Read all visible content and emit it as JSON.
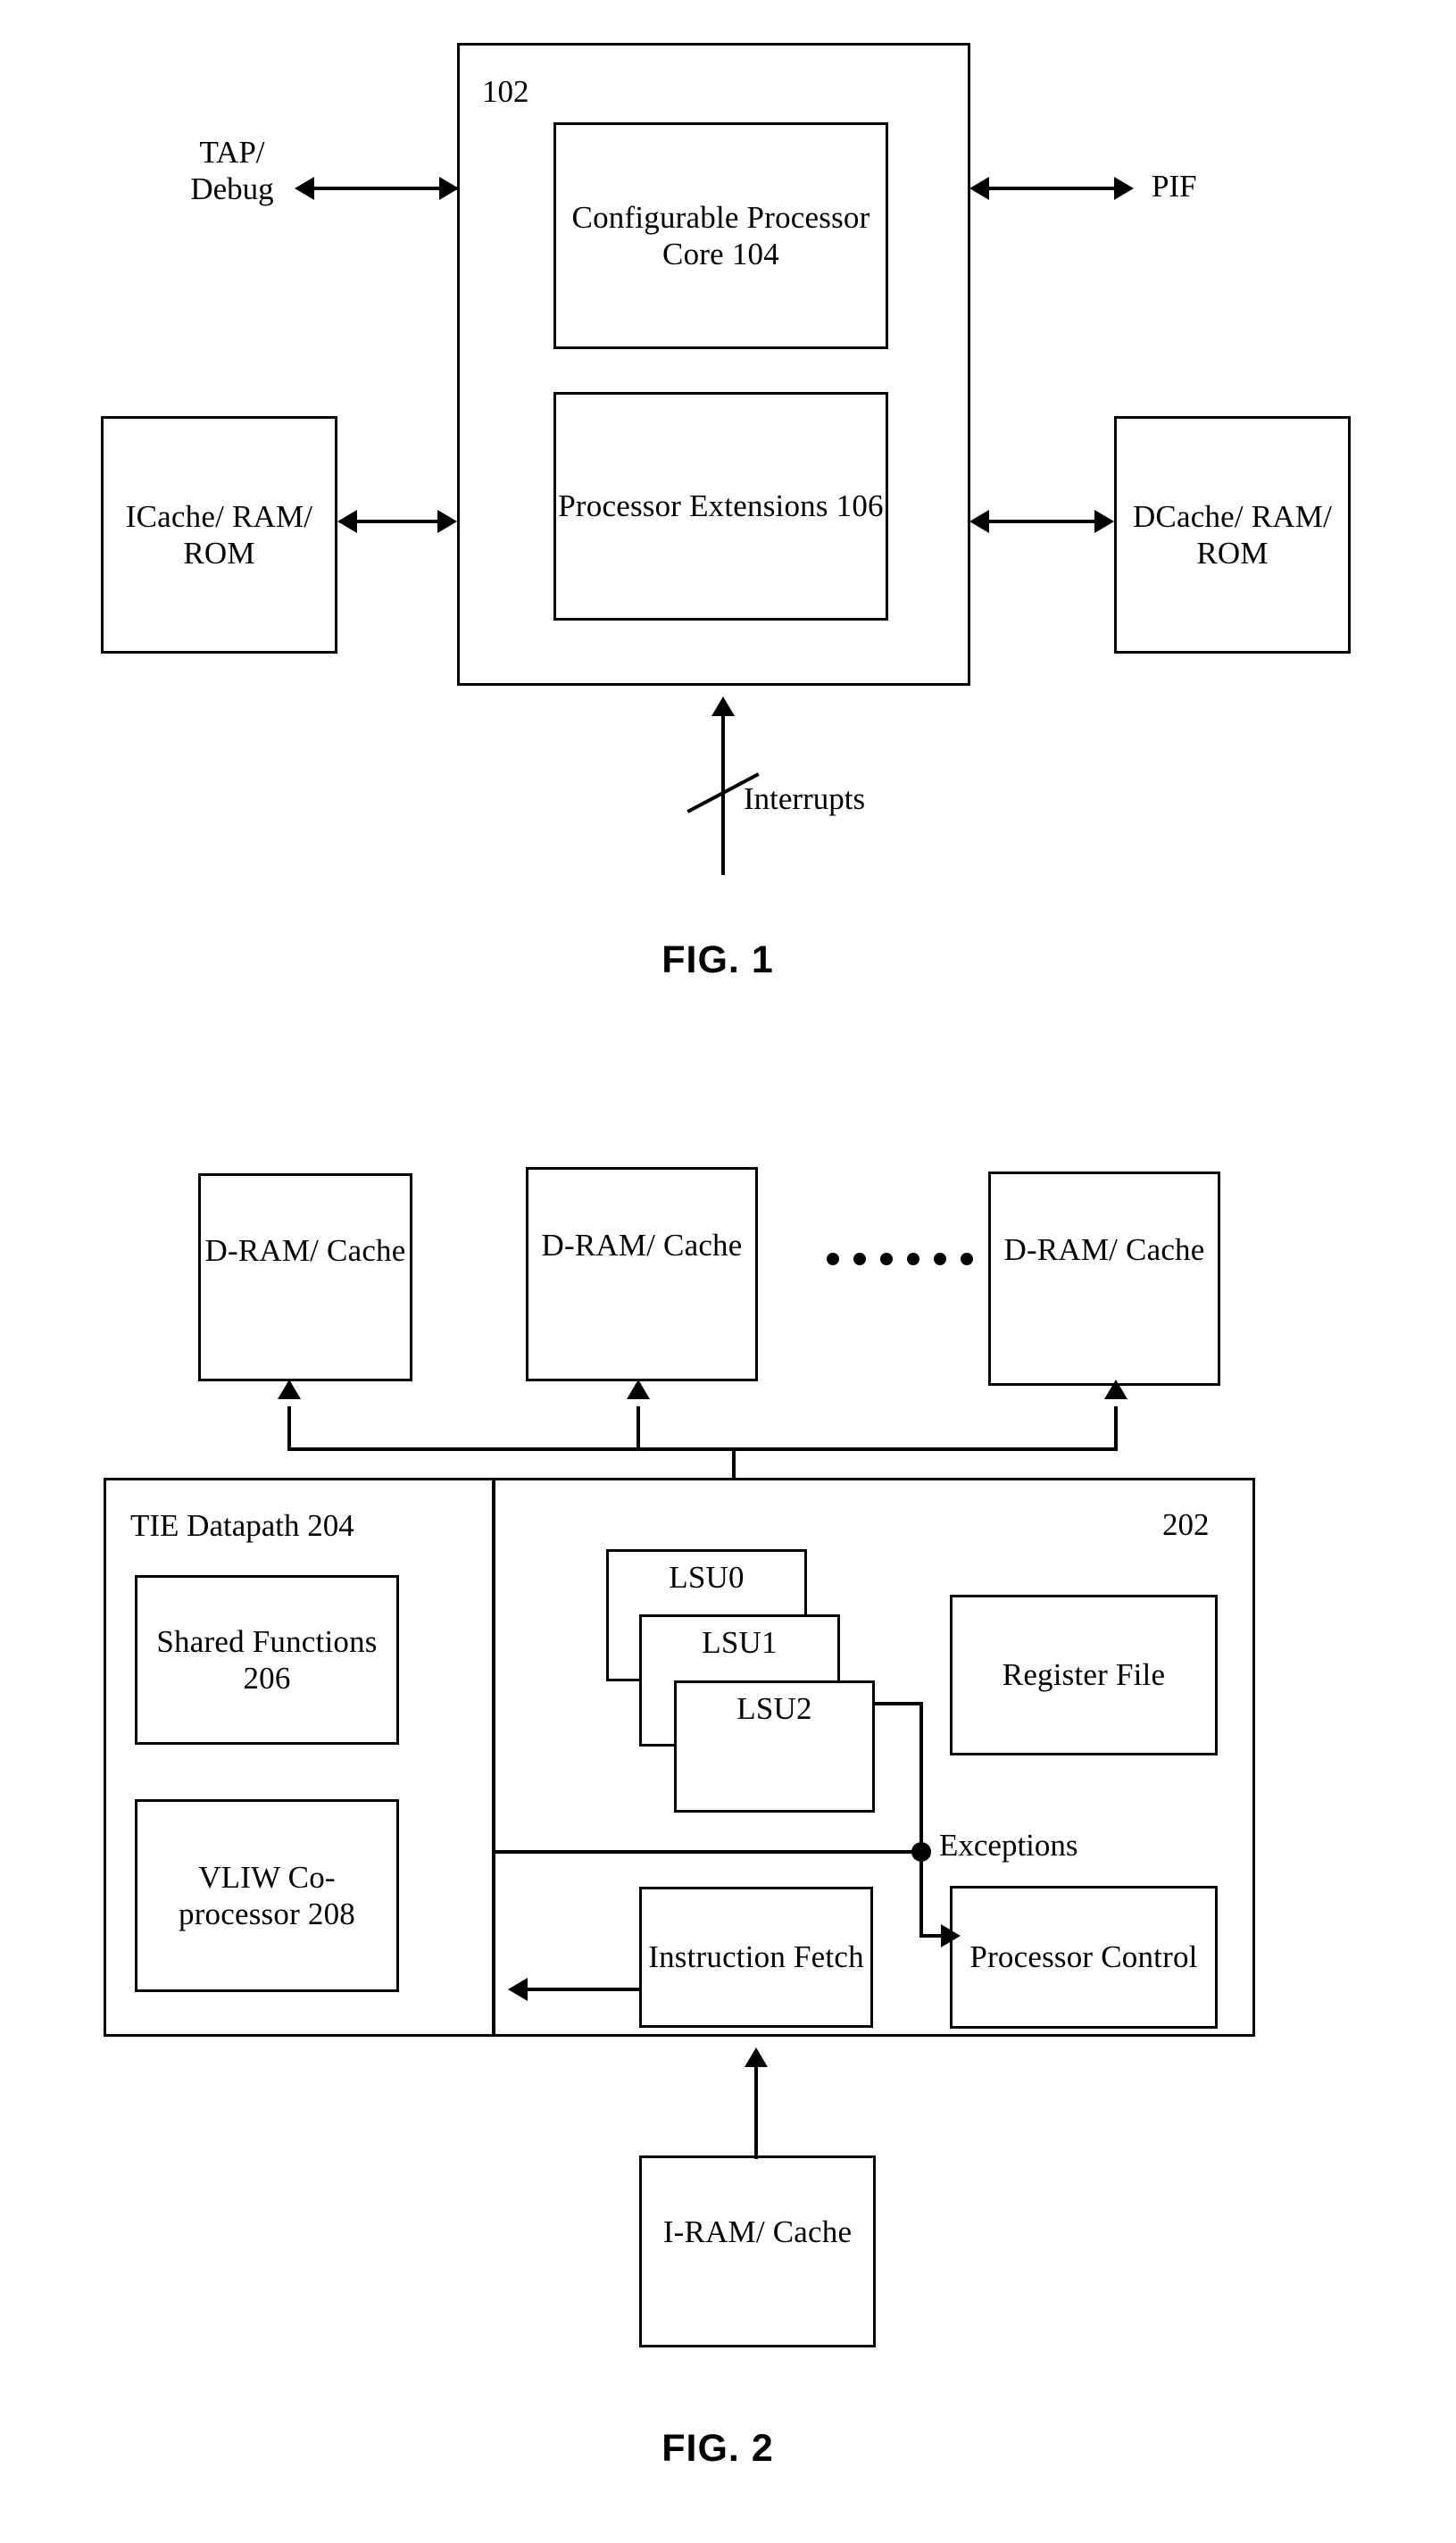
{
  "figures": [
    {
      "caption": "FIG. 1",
      "outer_ref": "102",
      "inner_blocks": [
        {
          "label": "Configurable\nProcessor Core\n104"
        },
        {
          "label": "Processor\nExtensions\n106"
        }
      ],
      "side_labels": {
        "left_top": "TAP/\nDebug",
        "right_top": "PIF",
        "bottom": "Interrupts"
      },
      "side_blocks": [
        {
          "label": "ICache/\nRAM/\nROM"
        },
        {
          "label": "DCache/\nRAM/\nROM"
        }
      ]
    },
    {
      "caption": "FIG. 2",
      "outer_ref": "202",
      "memory_blocks": [
        {
          "label": "D-RAM/\nCache"
        },
        {
          "label": "D-RAM/\nCache"
        },
        {
          "label": "D-RAM/\nCache"
        }
      ],
      "ellipsis_dot_count": 6,
      "datapath": {
        "title": "TIE Datapath 204",
        "blocks": [
          {
            "label": "Shared\nFunctions\n206"
          },
          {
            "label": "VLIW Co-\nprocessor\n208"
          }
        ]
      },
      "lsu_blocks": [
        {
          "label": "LSU0"
        },
        {
          "label": "LSU1"
        },
        {
          "label": "LSU2"
        }
      ],
      "core_blocks": [
        {
          "label": "Register\nFile"
        },
        {
          "label": "Processor\nControl"
        },
        {
          "label": "Instruction\nFetch"
        }
      ],
      "signal_labels": {
        "exceptions": "Exceptions"
      },
      "instruction_memory": {
        "label": "I-RAM/\nCache"
      }
    }
  ]
}
